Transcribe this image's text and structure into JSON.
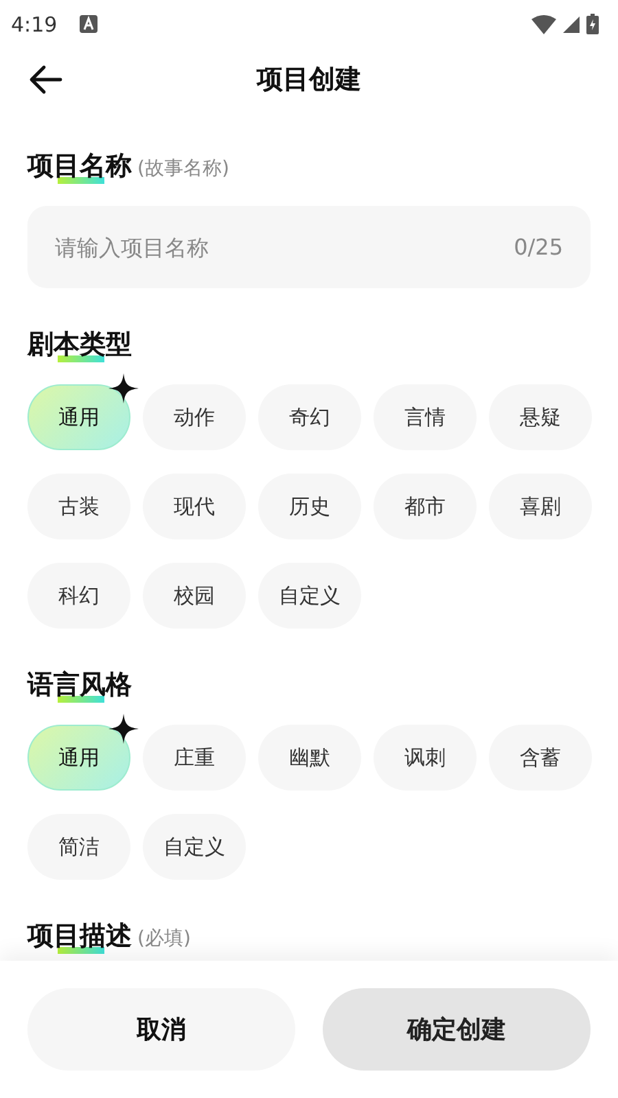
{
  "status_bar": {
    "time": "4:19"
  },
  "header": {
    "title": "项目创建"
  },
  "name_section": {
    "title": "项目名称",
    "hint": "(故事名称)",
    "field": {
      "placeholder": "请输入项目名称",
      "counter": "0/25"
    }
  },
  "genre_section": {
    "title": "剧本类型",
    "chips": [
      {
        "label": "通用",
        "selected": true
      },
      {
        "label": "动作",
        "selected": false
      },
      {
        "label": "奇幻",
        "selected": false
      },
      {
        "label": "言情",
        "selected": false
      },
      {
        "label": "悬疑",
        "selected": false
      },
      {
        "label": "古装",
        "selected": false
      },
      {
        "label": "现代",
        "selected": false
      },
      {
        "label": "历史",
        "selected": false
      },
      {
        "label": "都市",
        "selected": false
      },
      {
        "label": "喜剧",
        "selected": false
      },
      {
        "label": "科幻",
        "selected": false
      },
      {
        "label": "校园",
        "selected": false
      },
      {
        "label": "自定义",
        "selected": false
      }
    ]
  },
  "style_section": {
    "title": "语言风格",
    "chips": [
      {
        "label": "通用",
        "selected": true
      },
      {
        "label": "庄重",
        "selected": false
      },
      {
        "label": "幽默",
        "selected": false
      },
      {
        "label": "讽刺",
        "selected": false
      },
      {
        "label": "含蓄",
        "selected": false
      },
      {
        "label": "简洁",
        "selected": false
      },
      {
        "label": "自定义",
        "selected": false
      }
    ]
  },
  "description_section": {
    "title": "项目描述",
    "hint": "(必填)"
  },
  "buttons": {
    "cancel": {
      "label": "取消"
    },
    "confirm": {
      "label": "确定创建",
      "disabled": true
    }
  }
}
